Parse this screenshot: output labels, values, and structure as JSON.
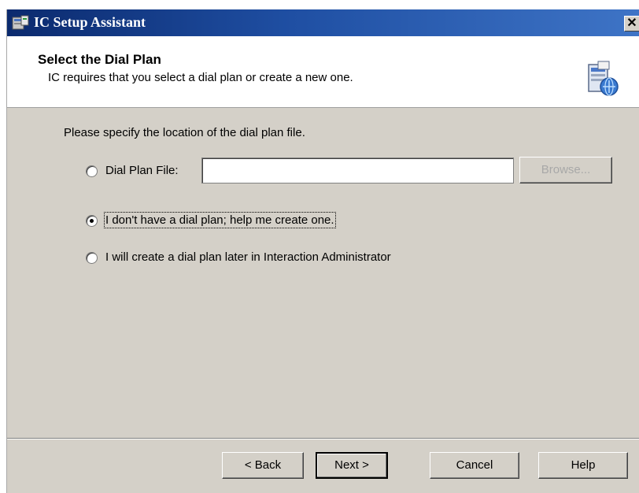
{
  "window": {
    "title": "IC Setup Assistant",
    "close_glyph": "✕"
  },
  "header": {
    "title": "Select the Dial Plan",
    "subtitle": "IC requires that you select a dial plan or create a new one.",
    "icon": "setup-wizard-icon"
  },
  "content": {
    "prompt": "Please specify the location of the dial plan file.",
    "options": [
      {
        "label": "Dial Plan File:",
        "checked": false
      },
      {
        "label": "I don't have a dial plan; help me create one.",
        "checked": true
      },
      {
        "label": "I will create a dial plan later in Interaction Administrator",
        "checked": false
      }
    ],
    "file_input": {
      "value": "",
      "placeholder": ""
    },
    "browse_label": "Browse..."
  },
  "footer": {
    "back_label": "< Back",
    "next_label": "Next >",
    "cancel_label": "Cancel",
    "help_label": "Help"
  },
  "colors": {
    "title_bar": "#1f4fa3",
    "dialog_face": "#d4d0c8"
  }
}
